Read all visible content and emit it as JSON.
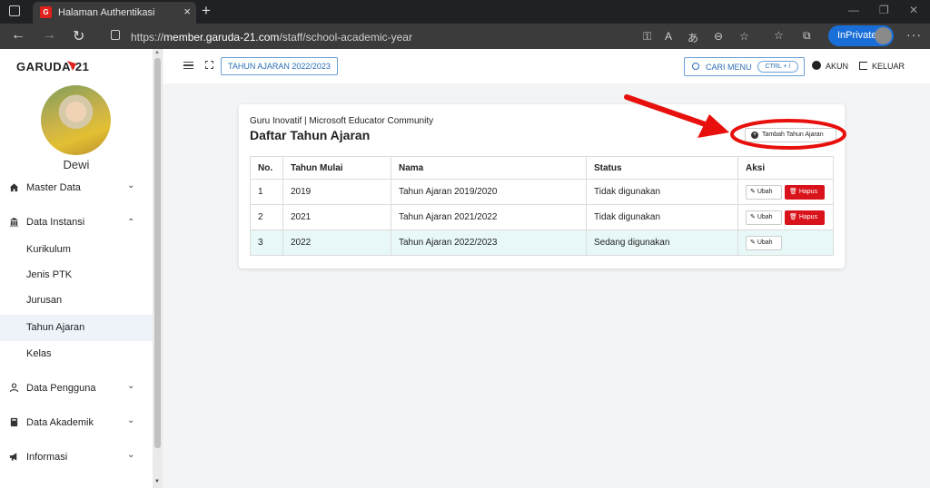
{
  "browser": {
    "tab_title": "Halaman Authentikasi",
    "url_prefix": "https://",
    "url_host": "member.garuda-21.com",
    "url_path": "/staff/school-academic-year",
    "inprivate_label": "InPrivate"
  },
  "sidebar": {
    "logo_text": "GARUDA-21",
    "user_name": "Dewi",
    "menu": [
      {
        "label": "Master Data",
        "icon": "home-icon",
        "expanded": false
      },
      {
        "label": "Data Instansi",
        "icon": "institution-icon",
        "expanded": true
      },
      {
        "label": "Data Pengguna",
        "icon": "user-icon",
        "expanded": false
      },
      {
        "label": "Data Akademik",
        "icon": "book-icon",
        "expanded": false
      },
      {
        "label": "Informasi",
        "icon": "megaphone-icon",
        "expanded": false
      }
    ],
    "submenu": [
      {
        "label": "Kurikulum"
      },
      {
        "label": "Jenis PTK"
      },
      {
        "label": "Jurusan"
      },
      {
        "label": "Tahun Ajaran",
        "active": true
      },
      {
        "label": "Kelas"
      }
    ]
  },
  "topbar": {
    "year_button": "TAHUN AJARAN 2022/2023",
    "search_label": "CARI MENU",
    "search_shortcut": "CTRL + /",
    "account_label": "AKUN",
    "logout_label": "KELUAR"
  },
  "card": {
    "subtitle": "Guru Inovatif | Microsoft Educator Community",
    "title": "Daftar Tahun Ajaran",
    "add_button": "Tambah Tahun Ajaran",
    "columns": [
      "No.",
      "Tahun Mulai",
      "Nama",
      "Status",
      "Aksi"
    ],
    "rows": [
      {
        "no": "1",
        "tahun_mulai": "2019",
        "nama": "Tahun Ajaran 2019/2020",
        "status": "Tidak digunakan",
        "can_delete": true
      },
      {
        "no": "2",
        "tahun_mulai": "2021",
        "nama": "Tahun Ajaran 2021/2022",
        "status": "Tidak digunakan",
        "can_delete": true
      },
      {
        "no": "3",
        "tahun_mulai": "2022",
        "nama": "Tahun Ajaran 2022/2023",
        "status": "Sedang digunakan",
        "can_delete": false
      }
    ],
    "edit_label": "Ubah",
    "delete_label": "Hapus"
  },
  "colors": {
    "accent": "#2a6db5",
    "danger": "#d9131b",
    "annotation": "#e8100c",
    "row_highlight": "#e8f8f8"
  }
}
